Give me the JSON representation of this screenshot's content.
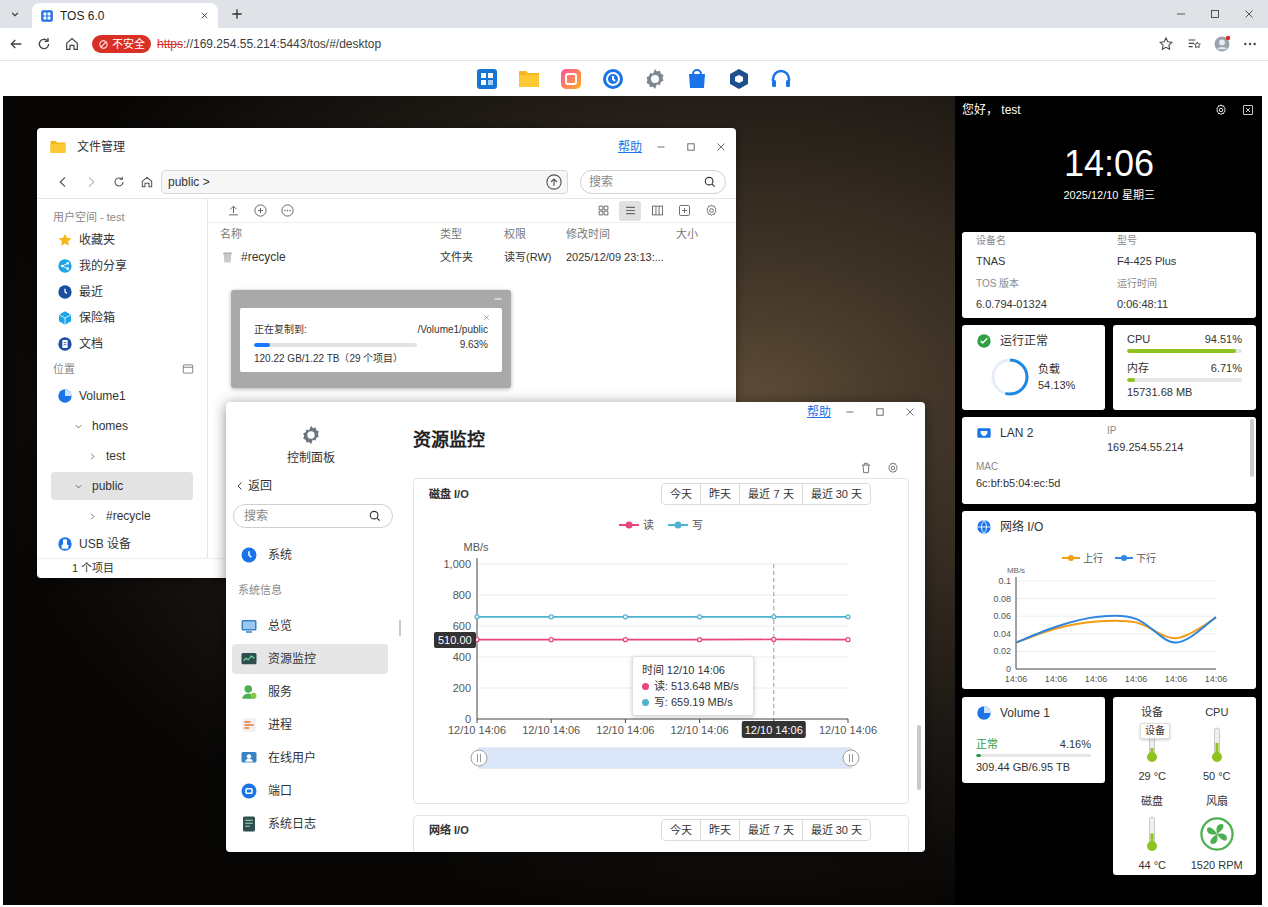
{
  "browser": {
    "tab_title": "TOS 6.0",
    "security_badge": "不安全",
    "url_scheme": "https",
    "url_rest": "://169.254.55.214:5443/tos/#/desktop"
  },
  "file_manager": {
    "title": "文件管理",
    "help": "帮助",
    "path": "public >",
    "search_placeholder": "搜索",
    "sidebar": [
      {
        "kind": "heading",
        "label": "用户空间 - test"
      },
      {
        "kind": "link",
        "label": "收藏夹",
        "selected": false
      },
      {
        "kind": "link",
        "label": "我的分享",
        "selected": false
      },
      {
        "kind": "link",
        "label": "最近",
        "selected": false
      },
      {
        "kind": "link",
        "label": "保险箱",
        "selected": false
      },
      {
        "kind": "link",
        "label": "文档",
        "selected": false
      },
      {
        "kind": "heading",
        "label": "位置"
      },
      {
        "kind": "volume",
        "label": "Volume1",
        "selected": false
      },
      {
        "kind": "folder",
        "label": "homes",
        "depth": 1,
        "expanded": true,
        "selected": false
      },
      {
        "kind": "folder",
        "label": "test",
        "depth": 2,
        "expanded": false,
        "selected": false
      },
      {
        "kind": "folder",
        "label": "public",
        "depth": 1,
        "expanded": true,
        "selected": true
      },
      {
        "kind": "folder",
        "label": "#recycle",
        "depth": 2,
        "expanded": false,
        "selected": false
      },
      {
        "kind": "link",
        "label": "USB 设备",
        "selected": false
      }
    ],
    "view_modes": [
      {
        "selected": false
      },
      {
        "selected": true
      },
      {
        "selected": false
      }
    ],
    "columns": [
      "名称",
      "类型",
      "权限",
      "修改时间",
      "大小"
    ],
    "rows": [
      {
        "cells": [
          "#recycle",
          "文件夹",
          "读写(RW)",
          "2025/12/09 23:13:..."
        ],
        "selected": false
      }
    ],
    "status": "1 个项目"
  },
  "copy_dialog": {
    "label": "正在复制到:",
    "dest": "/Volume1/public",
    "percent": "9.63%",
    "level": 0.0963,
    "detail": "120.22 GB/1.22 TB（29 个项目）"
  },
  "control_panel": {
    "help": "帮助",
    "app_label": "控制面板",
    "back": "返回",
    "search_placeholder": "搜索",
    "nav": [
      {
        "kind": "item",
        "label": "系统",
        "selected": false
      },
      {
        "kind": "heading",
        "label": "系统信息"
      },
      {
        "kind": "item",
        "label": "总览",
        "selected": false
      },
      {
        "kind": "item",
        "label": "资源监控",
        "selected": true
      },
      {
        "kind": "item",
        "label": "服务",
        "selected": false
      },
      {
        "kind": "item",
        "label": "进程",
        "selected": false
      },
      {
        "kind": "item",
        "label": "在线用户",
        "selected": false
      },
      {
        "kind": "item",
        "label": "端口",
        "selected": false
      },
      {
        "kind": "item",
        "label": "系统日志",
        "selected": false
      }
    ],
    "title": "资源监控",
    "disk_io": {
      "title": "磁盘 I/O",
      "ranges": [
        {
          "label": "今天",
          "selected": false
        },
        {
          "label": "昨天",
          "selected": false
        },
        {
          "label": "最近 7 天",
          "selected": false
        },
        {
          "label": "最近 30 天",
          "selected": false
        }
      ],
      "unit": "MB/s",
      "y_ticks": [
        "1,000",
        "800",
        "600",
        "400",
        "200",
        "0"
      ],
      "x_ticks": [
        {
          "label": "12/10 14:06",
          "selected": false
        },
        {
          "label": "12/10 14:06",
          "selected": false
        },
        {
          "label": "12/10 14:06",
          "selected": false
        },
        {
          "label": "12/10 14:06",
          "selected": false
        },
        {
          "label": "12/10 14:06",
          "selected": true
        },
        {
          "label": "12/10 14:06",
          "selected": false
        }
      ],
      "series": [
        {
          "label": "读",
          "color": "#e8457a",
          "values": [
            512,
            512,
            512,
            512,
            513.648,
            512
          ]
        },
        {
          "label": "写",
          "color": "#4fb3cf",
          "values": [
            659,
            659,
            659,
            659,
            659.19,
            659
          ]
        }
      ],
      "crosshair_label": "510.00",
      "crosshair_value": 510,
      "tooltip": {
        "time": "时间 12/10 14:06",
        "lines": [
          {
            "text": "读: 513.648 MB/s",
            "color": "#e8457a"
          },
          {
            "text": "写: 659.19 MB/s",
            "color": "#4fb3cf"
          }
        ]
      },
      "zoom": {
        "start": 0,
        "end": 1
      }
    },
    "network_io": {
      "title": "网络 I/O",
      "ranges": [
        {
          "label": "今天",
          "selected": false
        },
        {
          "label": "昨天",
          "selected": false
        },
        {
          "label": "最近 7 天",
          "selected": false
        },
        {
          "label": "最近 30 天",
          "selected": false
        }
      ]
    }
  },
  "widgets": {
    "greeting": "您好， test",
    "clock": {
      "time": "14:06",
      "date": "2025/12/10 星期三"
    },
    "device": [
      {
        "label": "设备名",
        "value": "TNAS"
      },
      {
        "label": "型号",
        "value": "F4-425 Plus"
      },
      {
        "label": "TOS 版本",
        "value": "6.0.794-01324"
      },
      {
        "label": "运行时间",
        "value": "0:06:48:11"
      }
    ],
    "health": {
      "status": "运行正常",
      "ok": true,
      "load_label": "负载",
      "load": "54.13%",
      "load_level": 0.5413
    },
    "usage": [
      {
        "label": "CPU",
        "value": "94.51%",
        "level": 0.9451
      },
      {
        "label": "内存",
        "value": "6.71%",
        "level": 0.0671,
        "detail": "15731.68 MB"
      }
    ],
    "lan": {
      "name": "LAN 2",
      "ip_label": "IP",
      "ip": "169.254.55.214",
      "mac_label": "MAC",
      "mac": "6c:bf:b5:04:ec:5d"
    },
    "network": {
      "title": "网络 I/O",
      "unit": "MB/s",
      "y_ticks": [
        "0.1",
        "0.08",
        "0.06",
        "0.04",
        "0.02",
        "0"
      ],
      "x_ticks": [
        "14:06",
        "14:06",
        "14:06",
        "14:06",
        "14:06",
        "14:06"
      ],
      "series": [
        {
          "label": "上行",
          "color": "#f39c12",
          "values": [
            0.03,
            0.046,
            0.054,
            0.053,
            0.035,
            0.058
          ]
        },
        {
          "label": "下行",
          "color": "#2e86de",
          "values": [
            0.03,
            0.048,
            0.059,
            0.057,
            0.03,
            0.059
          ]
        }
      ]
    },
    "volume": {
      "name": "Volume 1",
      "status": "正常",
      "percent": "4.16%",
      "level": 0.0416,
      "capacity": "309.44 GB/6.95 TB"
    },
    "sensors": [
      {
        "kind": "thermo",
        "label": "设备",
        "value": "29 °C",
        "level": 0.29
      },
      {
        "kind": "thermo",
        "label": "CPU",
        "value": "50 °C",
        "level": 0.5
      },
      {
        "kind": "thermo",
        "label": "磁盘",
        "value": "44 °C",
        "level": 0.44
      },
      {
        "kind": "fan",
        "label": "风扇",
        "value": "1520 RPM"
      }
    ],
    "sensor_tooltip": "设备"
  }
}
